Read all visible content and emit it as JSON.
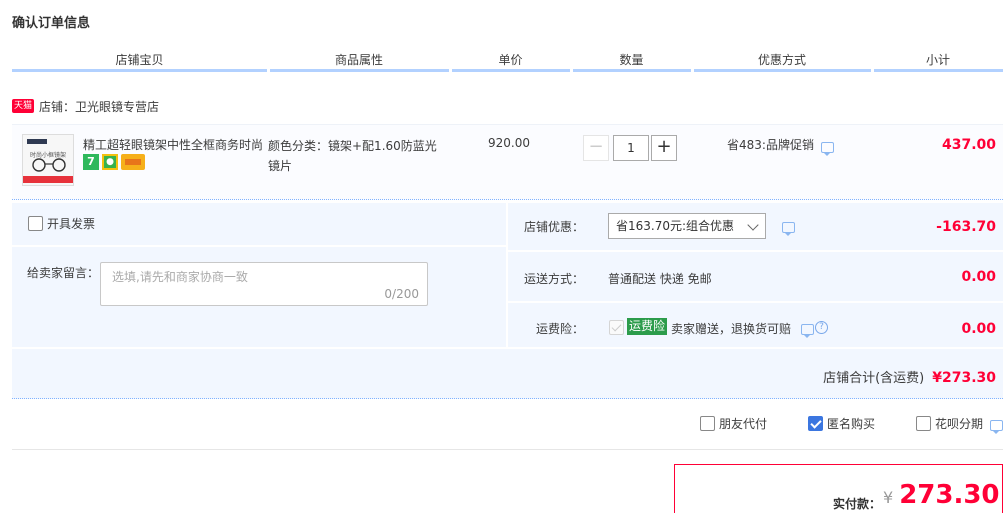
{
  "page": {
    "title": "确认订单信息"
  },
  "columns": [
    "店铺宝贝",
    "商品属性",
    "单价",
    "数量",
    "优惠方式",
    "小计"
  ],
  "shop": {
    "badge": "天猫",
    "label": "店铺：卫光眼镜专营店"
  },
  "item": {
    "thumb_title": "时尚小框镜架",
    "title": "精工超轻眼镜架中性全框商务时尚",
    "attributes": "颜色分类：镜架+配1.60防蓝光镜片",
    "unit_price": "920.00",
    "quantity": "1",
    "minus": "−",
    "plus": "+",
    "promotion": "省483:品牌促销",
    "subtotal": "437.00",
    "badge_7": "7"
  },
  "extras": {
    "invoice_label": "开具发票",
    "message_label": "给卖家留言：",
    "message_placeholder": "选填,请先和商家协商一致",
    "message_count": "0/200",
    "shop_discount_label": "店铺优惠：",
    "shop_discount_selected": "省163.70元:组合优惠",
    "shop_discount_value": "-163.70",
    "shipping_label": "运送方式：",
    "shipping_text": "普通配送 快递 免邮",
    "shipping_value": "0.00",
    "insurance_label": "运费险：",
    "insurance_badge": "运费险",
    "insurance_text": "卖家赠送，退换货可赔",
    "insurance_value": "0.00",
    "help_mark": "?",
    "shop_total_label": "店铺合计(含运费)",
    "shop_total_value": "¥273.30"
  },
  "options": {
    "friend_pay": "朋友代付",
    "anonymous": "匿名购买",
    "huabei": "花呗分期"
  },
  "payment": {
    "label": "实付款：",
    "currency": "¥",
    "amount": "273.30"
  }
}
